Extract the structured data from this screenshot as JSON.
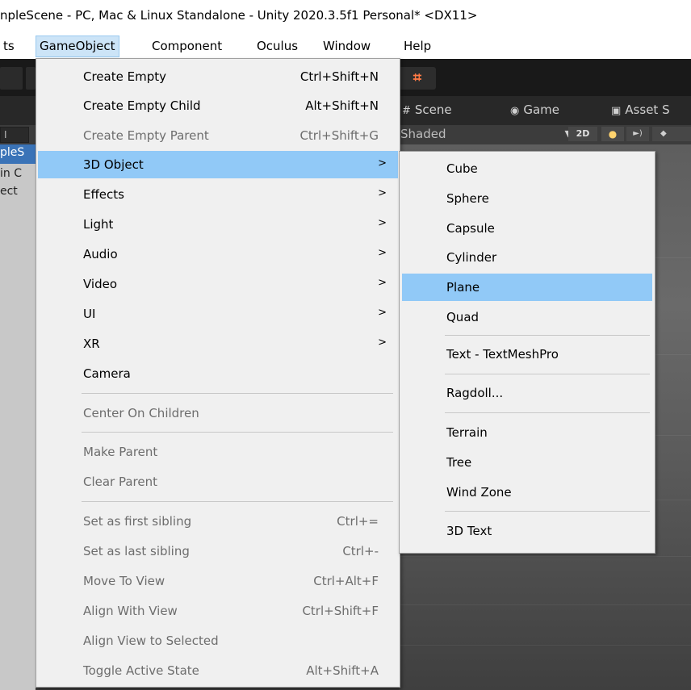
{
  "window": {
    "title": "npleScene - PC, Mac & Linux Standalone - Unity 2020.3.5f1 Personal* <DX11>"
  },
  "menubar": {
    "items": [
      "ts",
      "GameObject",
      "Component",
      "Oculus",
      "Window",
      "Help"
    ],
    "open_menu": "GameObject"
  },
  "editor": {
    "tabs": [
      {
        "icon": "#",
        "label": "Scene"
      },
      {
        "icon": "⚭",
        "label": "Game"
      },
      {
        "icon": "🔒",
        "label": "Asset S"
      }
    ],
    "shading_mode": "Shaded",
    "btn_2d": "2D",
    "grid_icon": "grid-icon",
    "hierarchy_search_placeholder": "I",
    "hierarchy_lines": [
      "pleS",
      "in C",
      "ect"
    ]
  },
  "gameobject_menu": {
    "items": [
      {
        "label": "Create Empty",
        "shortcut": "Ctrl+Shift+N",
        "enabled": true
      },
      {
        "label": "Create Empty Child",
        "shortcut": "Alt+Shift+N",
        "enabled": true
      },
      {
        "label": "Create Empty Parent",
        "shortcut": "Ctrl+Shift+G",
        "enabled": false
      },
      {
        "label": "3D Object",
        "submenu": true,
        "enabled": true,
        "highlighted": true
      },
      {
        "label": "Effects",
        "submenu": true,
        "enabled": true
      },
      {
        "label": "Light",
        "submenu": true,
        "enabled": true
      },
      {
        "label": "Audio",
        "submenu": true,
        "enabled": true
      },
      {
        "label": "Video",
        "submenu": true,
        "enabled": true
      },
      {
        "label": "UI",
        "submenu": true,
        "enabled": true
      },
      {
        "label": "XR",
        "submenu": true,
        "enabled": true
      },
      {
        "label": "Camera",
        "enabled": true
      },
      {
        "label": "Center On Children",
        "enabled": false
      },
      {
        "label": "Make Parent",
        "enabled": false
      },
      {
        "label": "Clear Parent",
        "enabled": false
      },
      {
        "label": "Set as first sibling",
        "shortcut": "Ctrl+=",
        "enabled": false
      },
      {
        "label": "Set as last sibling",
        "shortcut": "Ctrl+-",
        "enabled": false
      },
      {
        "label": "Move To View",
        "shortcut": "Ctrl+Alt+F",
        "enabled": false
      },
      {
        "label": "Align With View",
        "shortcut": "Ctrl+Shift+F",
        "enabled": false
      },
      {
        "label": "Align View to Selected",
        "enabled": false
      },
      {
        "label": "Toggle Active State",
        "shortcut": "Alt+Shift+A",
        "enabled": false
      }
    ],
    "submenu_arrow": ">"
  },
  "object3d_submenu": {
    "items": [
      "Cube",
      "Sphere",
      "Capsule",
      "Cylinder",
      "Plane",
      "Quad",
      "Text - TextMeshPro",
      "Ragdoll...",
      "Terrain",
      "Tree",
      "Wind Zone",
      "3D Text"
    ],
    "highlighted": "Plane"
  },
  "colors": {
    "menu_bg": "#f0f0f0",
    "highlight": "#91c9f7",
    "disabled_text": "#6d6d6d",
    "menubar_open": "#cce4f7"
  }
}
